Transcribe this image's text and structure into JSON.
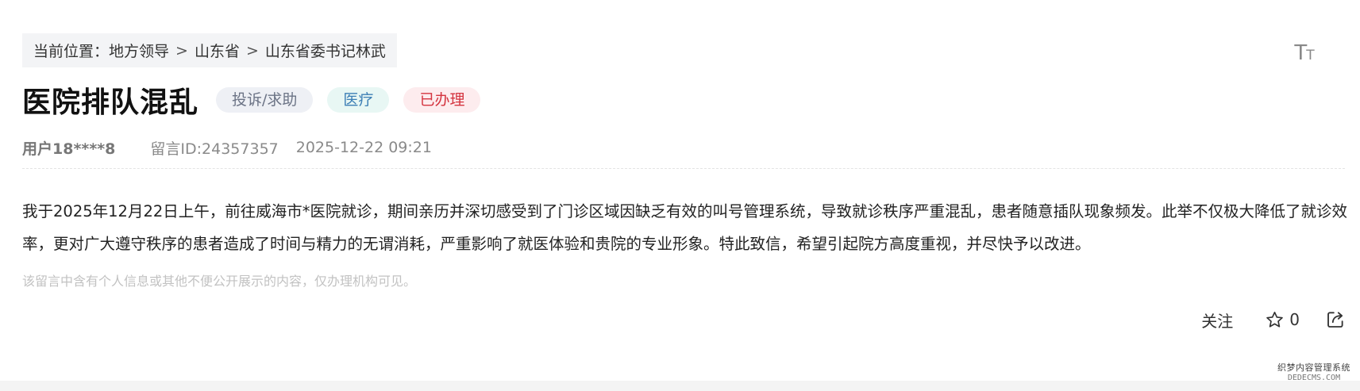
{
  "breadcrumb": {
    "prefix": "当前位置：",
    "items": [
      "地方领导",
      "山东省",
      "山东省委书记林武"
    ],
    "separator": ">"
  },
  "font_size_toggle": {
    "big": "T",
    "small": "T"
  },
  "message": {
    "title": "医院排队混乱",
    "tags": {
      "type": "投诉/求助",
      "field": "医疗",
      "status": "已办理"
    },
    "author": "用户18****8",
    "id_text": "留言ID:24357357",
    "timestamp": "2025-12-22 09:21",
    "body": "我于2025年12月22日上午，前往威海市*医院就诊，期间亲历并深切感受到了门诊区域因缺乏有效的叫号管理系统，导致就诊秩序严重混乱，患者随意插队现象频发。此举不仅极大降低了就诊效率，更对广大遵守秩序的患者造成了时间与精力的无谓消耗，严重影响了就医体验和贵院的专业形象。特此致信，希望引起院方高度重视，并尽快予以改进。",
    "privacy_notice": "该留言中含有个人信息或其他不便公开展示的内容，仅办理机构可见。"
  },
  "actions": {
    "follow_label": "关注",
    "star_count": "0",
    "icons": [
      "star-icon",
      "share-icon"
    ]
  },
  "watermark": {
    "line1": "织梦内容管理系统",
    "line2": "DEDECMS.COM"
  },
  "colors": {
    "tag_type_bg": "#eef0f5",
    "tag_field_bg": "#e8f7f4",
    "tag_status_bg": "#fdecee",
    "tag_status_text": "#d4343f",
    "tag_field_text": "#3d7fb5"
  }
}
